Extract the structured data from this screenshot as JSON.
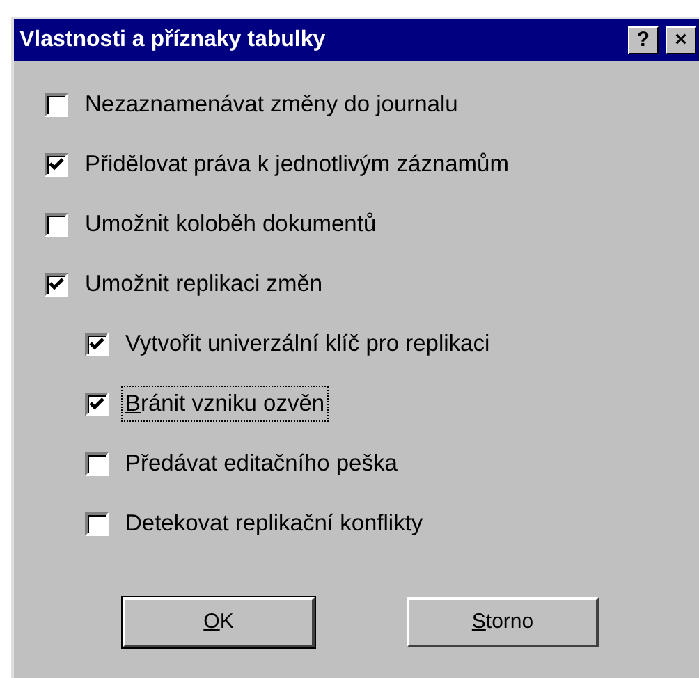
{
  "window": {
    "title": "Vlastnosti a příznaky tabulky",
    "title_buttons": [
      {
        "kind": "help",
        "label": "?"
      },
      {
        "kind": "close",
        "label": "×"
      }
    ]
  },
  "options": [
    {
      "label": "Nezaznamenávat změny do journalu",
      "checked": false,
      "focused": false,
      "underline_first": false
    },
    {
      "label": "Přidělovat práva k jednotlivým záznamům",
      "checked": true,
      "focused": false,
      "underline_first": false
    },
    {
      "label": "Umožnit koloběh dokumentů",
      "checked": false,
      "focused": false,
      "underline_first": false
    },
    {
      "label": "Umožnit replikaci změn",
      "checked": true,
      "focused": false,
      "underline_first": false,
      "children": [
        {
          "label": "Vytvořit univerzální klíč pro replikaci",
          "checked": true,
          "focused": false,
          "underline_first": false
        },
        {
          "label": "Bránit vzniku ozvěn",
          "checked": true,
          "focused": true,
          "underline_first": true
        },
        {
          "label": "Předávat editačního peška",
          "checked": false,
          "focused": false,
          "underline_first": false
        },
        {
          "label": "Detekovat replikační konflikty",
          "checked": false,
          "focused": false,
          "underline_first": false
        }
      ]
    }
  ],
  "buttons": [
    {
      "label": "OK",
      "default": true,
      "underline_first": true
    },
    {
      "label": "Storno",
      "default": false,
      "underline_first": true
    }
  ]
}
